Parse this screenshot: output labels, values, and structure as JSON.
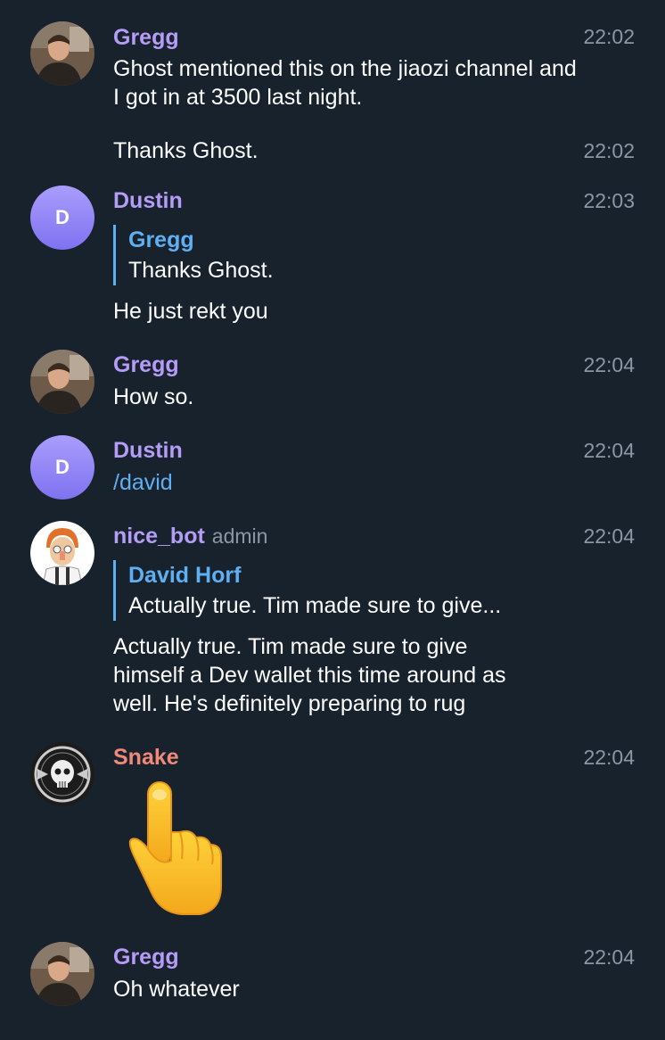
{
  "messages": [
    {
      "sender": "Gregg",
      "time": "22:02",
      "text": "Ghost mentioned this on the jiaozi channel and I got in at 3500 last night."
    },
    {
      "time": "22:02",
      "text": "Thanks Ghost."
    },
    {
      "sender": "Dustin",
      "avatar_letter": "D",
      "time": "22:03",
      "reply": {
        "name": "Gregg",
        "text": "Thanks Ghost."
      },
      "text": "He just rekt you"
    },
    {
      "sender": "Gregg",
      "time": "22:04",
      "text": "How so."
    },
    {
      "sender": "Dustin",
      "avatar_letter": "D",
      "time": "22:04",
      "text": "/david"
    },
    {
      "sender": "nice_bot",
      "role": "admin",
      "time": "22:04",
      "reply": {
        "name": "David Horf",
        "text": "Actually true. Tim made sure to give..."
      },
      "text": "Actually true. Tim made sure to give himself a Dev wallet this time around as well. He's definitely preparing to rug"
    },
    {
      "sender": "Snake",
      "time": "22:04",
      "sticker": "pointing-up-hand-emoji"
    },
    {
      "sender": "Gregg",
      "time": "22:04",
      "text": "Oh whatever"
    }
  ],
  "colors": {
    "background": "#18222d",
    "sender_name": "#b59cf7",
    "snake_name": "#f1897a",
    "link": "#5fb0f2",
    "time": "#8c97a3"
  }
}
